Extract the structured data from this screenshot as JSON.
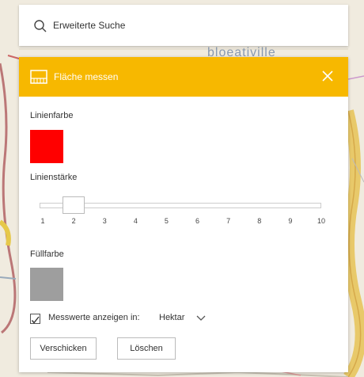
{
  "search": {
    "placeholder": "Erweiterte Suche",
    "icon": "search-icon"
  },
  "map": {
    "label": "bloeativille"
  },
  "panel": {
    "title": "Fläche messen",
    "header_color": "#f7b800",
    "line_color_label": "Linienfarbe",
    "line_color": "#ff0000",
    "line_width_label": "Linienstärke",
    "slider": {
      "min": 1,
      "max": 10,
      "value": 2,
      "ticks": [
        "1",
        "2",
        "3",
        "4",
        "5",
        "6",
        "7",
        "8",
        "9",
        "10"
      ]
    },
    "fill_color_label": "Füllfarbe",
    "fill_color": "#9e9e9e",
    "show_values_checked": true,
    "show_values_label": "Messwerte anzeigen in:",
    "unit": "Hektar",
    "send_button": "Verschicken",
    "delete_button": "Löschen"
  }
}
